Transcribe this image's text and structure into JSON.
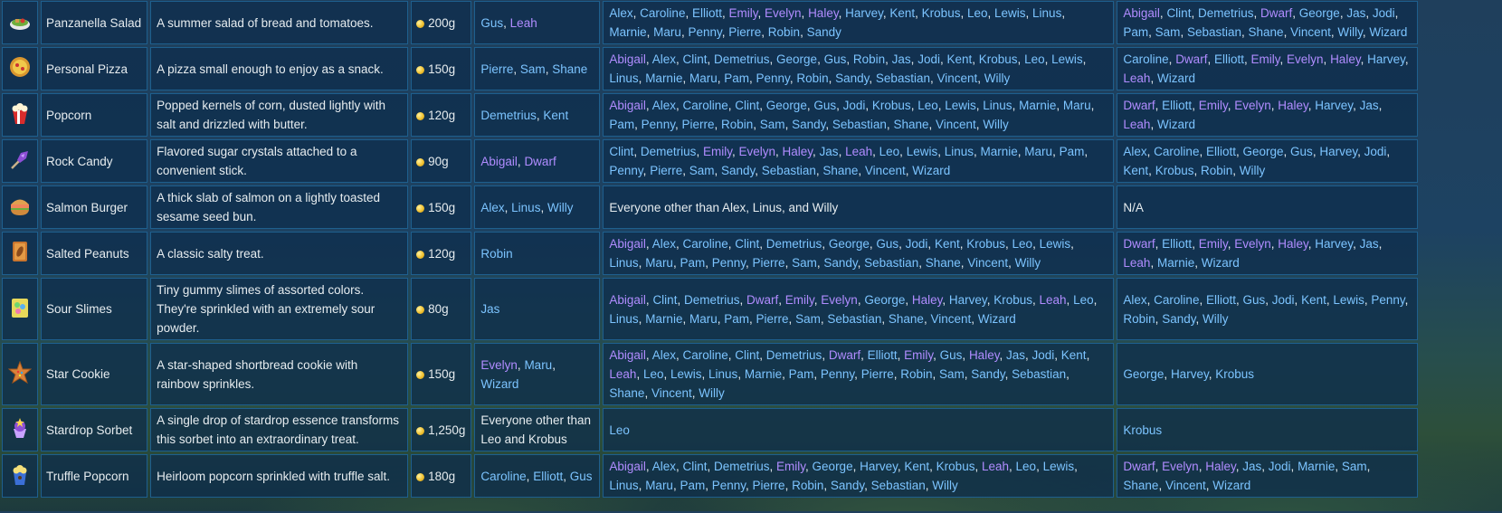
{
  "rows": [
    {
      "name": "Panzanella Salad",
      "icon": "panzanella-salad-icon",
      "description": "A summer salad of bread and tomatoes.",
      "price": "200g",
      "cooked_by": [
        {
          "t": "Gus"
        },
        {
          "t": "Leah",
          "v": true
        }
      ],
      "loved_by": [
        {
          "t": "Alex"
        },
        {
          "t": "Caroline"
        },
        {
          "t": "Elliott"
        },
        {
          "t": "Emily",
          "v": true
        },
        {
          "t": "Evelyn",
          "v": true
        },
        {
          "t": "Haley",
          "v": true
        },
        {
          "t": "Harvey"
        },
        {
          "t": "Kent"
        },
        {
          "t": "Krobus"
        },
        {
          "t": "Leo"
        },
        {
          "t": "Lewis"
        },
        {
          "t": "Linus"
        },
        {
          "t": "Marnie"
        },
        {
          "t": "Maru"
        },
        {
          "t": "Penny"
        },
        {
          "t": "Pierre"
        },
        {
          "t": "Robin"
        },
        {
          "t": "Sandy"
        }
      ],
      "disliked_by": [
        {
          "t": "Abigail",
          "v": true
        },
        {
          "t": "Clint"
        },
        {
          "t": "Demetrius"
        },
        {
          "t": "Dwarf",
          "v": true
        },
        {
          "t": "George"
        },
        {
          "t": "Jas"
        },
        {
          "t": "Jodi"
        },
        {
          "t": "Pam"
        },
        {
          "t": "Sam"
        },
        {
          "t": "Sebastian"
        },
        {
          "t": "Shane"
        },
        {
          "t": "Vincent"
        },
        {
          "t": "Willy"
        },
        {
          "t": "Wizard"
        }
      ]
    },
    {
      "name": "Personal Pizza",
      "icon": "personal-pizza-icon",
      "description": "A pizza small enough to enjoy as a snack.",
      "price": "150g",
      "cooked_by": [
        {
          "t": "Pierre"
        },
        {
          "t": "Sam"
        },
        {
          "t": "Shane"
        }
      ],
      "loved_by": [
        {
          "t": "Abigail",
          "v": true
        },
        {
          "t": "Alex"
        },
        {
          "t": "Clint"
        },
        {
          "t": "Demetrius"
        },
        {
          "t": "George"
        },
        {
          "t": "Gus"
        },
        {
          "t": "Robin"
        },
        {
          "t": "Jas"
        },
        {
          "t": "Jodi"
        },
        {
          "t": "Kent"
        },
        {
          "t": "Krobus"
        },
        {
          "t": "Leo"
        },
        {
          "t": "Lewis"
        },
        {
          "t": "Linus"
        },
        {
          "t": "Marnie"
        },
        {
          "t": "Maru"
        },
        {
          "t": "Pam"
        },
        {
          "t": "Penny"
        },
        {
          "t": "Robin"
        },
        {
          "t": "Sandy"
        },
        {
          "t": "Sebastian"
        },
        {
          "t": "Vincent"
        },
        {
          "t": "Willy"
        }
      ],
      "disliked_by": [
        {
          "t": "Caroline"
        },
        {
          "t": "Dwarf",
          "v": true
        },
        {
          "t": "Elliott"
        },
        {
          "t": "Emily",
          "v": true
        },
        {
          "t": "Evelyn",
          "v": true
        },
        {
          "t": "Haley",
          "v": true
        },
        {
          "t": "Harvey"
        },
        {
          "t": "Leah",
          "v": true
        },
        {
          "t": "Wizard"
        }
      ]
    },
    {
      "name": "Popcorn",
      "icon": "popcorn-icon",
      "description": "Popped kernels of corn, dusted lightly with salt and drizzled with butter.",
      "price": "120g",
      "cooked_by": [
        {
          "t": "Demetrius"
        },
        {
          "t": "Kent"
        }
      ],
      "loved_by": [
        {
          "t": "Abigail",
          "v": true
        },
        {
          "t": "Alex"
        },
        {
          "t": "Caroline"
        },
        {
          "t": "Clint"
        },
        {
          "t": "George"
        },
        {
          "t": "Gus"
        },
        {
          "t": "Jodi"
        },
        {
          "t": "Krobus"
        },
        {
          "t": "Leo"
        },
        {
          "t": "Lewis"
        },
        {
          "t": "Linus"
        },
        {
          "t": "Marnie"
        },
        {
          "t": "Maru"
        },
        {
          "t": "Pam"
        },
        {
          "t": "Penny"
        },
        {
          "t": "Pierre"
        },
        {
          "t": "Robin"
        },
        {
          "t": "Sam"
        },
        {
          "t": "Sandy"
        },
        {
          "t": "Sebastian"
        },
        {
          "t": "Shane"
        },
        {
          "t": "Vincent"
        },
        {
          "t": "Willy"
        }
      ],
      "disliked_by": [
        {
          "t": "Dwarf",
          "v": true
        },
        {
          "t": "Elliott"
        },
        {
          "t": "Emily",
          "v": true
        },
        {
          "t": "Evelyn",
          "v": true
        },
        {
          "t": "Haley",
          "v": true
        },
        {
          "t": "Harvey"
        },
        {
          "t": "Jas"
        },
        {
          "t": "Leah",
          "v": true
        },
        {
          "t": "Wizard"
        }
      ]
    },
    {
      "name": "Rock Candy",
      "icon": "rock-candy-icon",
      "description": "Flavored sugar crystals attached to a convenient stick.",
      "price": "90g",
      "cooked_by": [
        {
          "t": "Abigail",
          "v": true
        },
        {
          "t": "Dwarf",
          "v": true
        }
      ],
      "loved_by": [
        {
          "t": "Clint"
        },
        {
          "t": "Demetrius"
        },
        {
          "t": "Emily",
          "v": true
        },
        {
          "t": "Evelyn",
          "v": true
        },
        {
          "t": "Haley",
          "v": true
        },
        {
          "t": "Jas"
        },
        {
          "t": "Leah",
          "v": true
        },
        {
          "t": "Leo"
        },
        {
          "t": "Lewis"
        },
        {
          "t": "Linus"
        },
        {
          "t": "Marnie"
        },
        {
          "t": "Maru"
        },
        {
          "t": "Pam"
        },
        {
          "t": "Penny"
        },
        {
          "t": "Pierre"
        },
        {
          "t": "Sam"
        },
        {
          "t": "Sandy"
        },
        {
          "t": "Sebastian"
        },
        {
          "t": "Shane"
        },
        {
          "t": "Vincent"
        },
        {
          "t": "Wizard"
        }
      ],
      "disliked_by": [
        {
          "t": "Alex"
        },
        {
          "t": "Caroline"
        },
        {
          "t": "Elliott"
        },
        {
          "t": "George"
        },
        {
          "t": "Gus"
        },
        {
          "t": "Harvey"
        },
        {
          "t": "Jodi"
        },
        {
          "t": "Kent"
        },
        {
          "t": "Krobus"
        },
        {
          "t": "Robin"
        },
        {
          "t": "Willy"
        }
      ]
    },
    {
      "name": "Salmon Burger",
      "icon": "salmon-burger-icon",
      "description": "A thick slab of salmon on a lightly toasted sesame seed bun.",
      "price": "150g",
      "cooked_by": [
        {
          "t": "Alex"
        },
        {
          "t": "Linus"
        },
        {
          "t": "Willy"
        }
      ],
      "loved_by_text": "Everyone other than Alex, Linus, and Willy",
      "disliked_by_text": "N/A"
    },
    {
      "name": "Salted Peanuts",
      "icon": "salted-peanuts-icon",
      "description": "A classic salty treat.",
      "price": "120g",
      "cooked_by": [
        {
          "t": "Robin"
        }
      ],
      "loved_by": [
        {
          "t": "Abigail",
          "v": true
        },
        {
          "t": "Alex"
        },
        {
          "t": "Caroline"
        },
        {
          "t": "Clint"
        },
        {
          "t": "Demetrius"
        },
        {
          "t": "George"
        },
        {
          "t": "Gus"
        },
        {
          "t": "Jodi"
        },
        {
          "t": "Kent"
        },
        {
          "t": "Krobus"
        },
        {
          "t": "Leo"
        },
        {
          "t": "Lewis"
        },
        {
          "t": "Linus"
        },
        {
          "t": "Maru"
        },
        {
          "t": "Pam"
        },
        {
          "t": "Penny"
        },
        {
          "t": "Pierre"
        },
        {
          "t": "Sam"
        },
        {
          "t": "Sandy"
        },
        {
          "t": "Sebastian"
        },
        {
          "t": "Shane"
        },
        {
          "t": "Vincent"
        },
        {
          "t": "Willy"
        }
      ],
      "disliked_by": [
        {
          "t": "Dwarf",
          "v": true
        },
        {
          "t": "Elliott"
        },
        {
          "t": "Emily",
          "v": true
        },
        {
          "t": "Evelyn",
          "v": true
        },
        {
          "t": "Haley",
          "v": true
        },
        {
          "t": "Harvey"
        },
        {
          "t": "Jas"
        },
        {
          "t": "Leah",
          "v": true
        },
        {
          "t": "Marnie"
        },
        {
          "t": "Wizard"
        }
      ]
    },
    {
      "name": "Sour Slimes",
      "icon": "sour-slimes-icon",
      "description": "Tiny gummy slimes of assorted colors. They're sprinkled with an extremely sour powder.",
      "price": "80g",
      "cooked_by": [
        {
          "t": "Jas"
        }
      ],
      "loved_by": [
        {
          "t": "Abigail",
          "v": true
        },
        {
          "t": "Clint"
        },
        {
          "t": "Demetrius"
        },
        {
          "t": "Dwarf",
          "v": true
        },
        {
          "t": "Emily",
          "v": true
        },
        {
          "t": "Evelyn",
          "v": true
        },
        {
          "t": "George"
        },
        {
          "t": "Haley",
          "v": true
        },
        {
          "t": "Harvey"
        },
        {
          "t": "Krobus"
        },
        {
          "t": "Leah",
          "v": true
        },
        {
          "t": "Leo"
        },
        {
          "t": "Linus"
        },
        {
          "t": "Marnie"
        },
        {
          "t": "Maru"
        },
        {
          "t": "Pam"
        },
        {
          "t": "Pierre"
        },
        {
          "t": "Sam"
        },
        {
          "t": "Sebastian"
        },
        {
          "t": "Shane"
        },
        {
          "t": "Vincent"
        },
        {
          "t": "Wizard"
        }
      ],
      "disliked_by": [
        {
          "t": "Alex"
        },
        {
          "t": "Caroline"
        },
        {
          "t": "Elliott"
        },
        {
          "t": "Gus"
        },
        {
          "t": "Jodi"
        },
        {
          "t": "Kent"
        },
        {
          "t": "Lewis"
        },
        {
          "t": "Penny"
        },
        {
          "t": "Robin"
        },
        {
          "t": "Sandy"
        },
        {
          "t": "Willy"
        }
      ]
    },
    {
      "name": "Star Cookie",
      "icon": "star-cookie-icon",
      "description": "A star-shaped shortbread cookie with rainbow sprinkles.",
      "price": "150g",
      "cooked_by": [
        {
          "t": "Evelyn",
          "v": true
        },
        {
          "t": "Maru"
        },
        {
          "t": "Wizard"
        }
      ],
      "loved_by": [
        {
          "t": "Abigail",
          "v": true
        },
        {
          "t": "Alex"
        },
        {
          "t": "Caroline"
        },
        {
          "t": "Clint"
        },
        {
          "t": "Demetrius"
        },
        {
          "t": "Dwarf",
          "v": true
        },
        {
          "t": "Elliott"
        },
        {
          "t": "Emily",
          "v": true
        },
        {
          "t": "Gus"
        },
        {
          "t": "Haley",
          "v": true
        },
        {
          "t": "Jas"
        },
        {
          "t": "Jodi"
        },
        {
          "t": "Kent"
        },
        {
          "t": "Leah",
          "v": true
        },
        {
          "t": "Leo"
        },
        {
          "t": "Lewis"
        },
        {
          "t": "Linus"
        },
        {
          "t": "Marnie"
        },
        {
          "t": "Pam"
        },
        {
          "t": "Penny"
        },
        {
          "t": "Pierre"
        },
        {
          "t": "Robin"
        },
        {
          "t": "Sam"
        },
        {
          "t": "Sandy"
        },
        {
          "t": "Sebastian"
        },
        {
          "t": "Shane"
        },
        {
          "t": "Vincent"
        },
        {
          "t": "Willy"
        }
      ],
      "disliked_by": [
        {
          "t": "George"
        },
        {
          "t": "Harvey"
        },
        {
          "t": "Krobus"
        }
      ]
    },
    {
      "name": "Stardrop Sorbet",
      "icon": "stardrop-sorbet-icon",
      "description": "A single drop of stardrop essence transforms this sorbet into an extraordinary treat.",
      "price": "1,250g",
      "cooked_by_text": "Everyone other than Leo and Krobus",
      "loved_by": [
        {
          "t": "Leo"
        }
      ],
      "disliked_by": [
        {
          "t": "Krobus"
        }
      ]
    },
    {
      "name": "Truffle Popcorn",
      "icon": "truffle-popcorn-icon",
      "description": "Heirloom popcorn sprinkled with truffle salt.",
      "price": "180g",
      "cooked_by": [
        {
          "t": "Caroline"
        },
        {
          "t": "Elliott"
        },
        {
          "t": "Gus"
        }
      ],
      "loved_by": [
        {
          "t": "Abigail",
          "v": true
        },
        {
          "t": "Alex"
        },
        {
          "t": "Clint"
        },
        {
          "t": "Demetrius"
        },
        {
          "t": "Emily",
          "v": true
        },
        {
          "t": "George"
        },
        {
          "t": "Harvey"
        },
        {
          "t": "Kent"
        },
        {
          "t": "Krobus"
        },
        {
          "t": "Leah",
          "v": true
        },
        {
          "t": "Leo"
        },
        {
          "t": "Lewis"
        },
        {
          "t": "Linus"
        },
        {
          "t": "Maru"
        },
        {
          "t": "Pam"
        },
        {
          "t": "Penny"
        },
        {
          "t": "Pierre"
        },
        {
          "t": "Robin"
        },
        {
          "t": "Sandy"
        },
        {
          "t": "Sebastian"
        },
        {
          "t": "Willy"
        }
      ],
      "disliked_by": [
        {
          "t": "Dwarf",
          "v": true
        },
        {
          "t": "Evelyn",
          "v": true
        },
        {
          "t": "Haley",
          "v": true
        },
        {
          "t": "Jas"
        },
        {
          "t": "Jodi"
        },
        {
          "t": "Marnie"
        },
        {
          "t": "Sam"
        },
        {
          "t": "Shane"
        },
        {
          "t": "Vincent"
        },
        {
          "t": "Wizard"
        }
      ]
    }
  ],
  "colors": {
    "link": "#7cc4ff",
    "visited_link": "#b08cff",
    "cell_border": "#1e5f8e",
    "coin": "#f1c232"
  }
}
